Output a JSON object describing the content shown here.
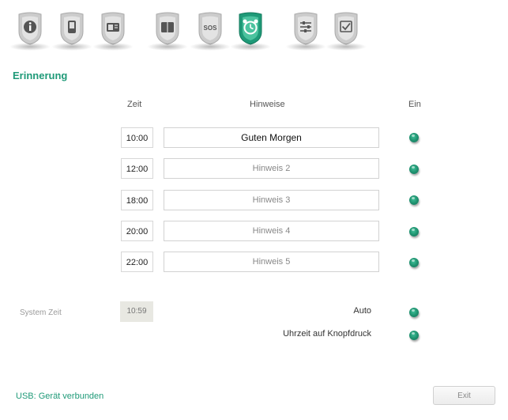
{
  "toolbar": {
    "icons": [
      {
        "name": "info-icon",
        "glyph": "i",
        "active": false
      },
      {
        "name": "phone-icon",
        "glyph": "▯",
        "active": false
      },
      {
        "name": "contact-card-icon",
        "glyph": "▭",
        "active": false
      },
      {
        "name": "phonebook-icon",
        "glyph": "▣",
        "active": false
      },
      {
        "name": "sos-icon",
        "glyph": "SOS",
        "active": false
      },
      {
        "name": "alarm-clock-icon",
        "glyph": "⏰",
        "active": true
      },
      {
        "name": "settings-sliders-icon",
        "glyph": "≡",
        "active": false
      },
      {
        "name": "checklist-icon",
        "glyph": "☑",
        "active": false
      }
    ],
    "colors": {
      "inactive": "#c9c9c9",
      "active": "#1f9a78"
    }
  },
  "section": {
    "title": "Erinnerung"
  },
  "table": {
    "headers": {
      "time": "Zeit",
      "notes": "Hinweise",
      "on": "Ein"
    },
    "rows": [
      {
        "time": "10:00",
        "note": "Guten Morgen",
        "active": true
      },
      {
        "time": "12:00",
        "note": "Hinweis 2",
        "active": false
      },
      {
        "time": "18:00",
        "note": "Hinweis 3",
        "active": false
      },
      {
        "time": "20:00",
        "note": "Hinweis 4",
        "active": false
      },
      {
        "time": "22:00",
        "note": "Hinweis 5",
        "active": false
      }
    ]
  },
  "system": {
    "label": "System Zeit",
    "time": "10:59",
    "options": [
      {
        "label": "Auto",
        "selected": true
      },
      {
        "label": "Uhrzeit auf Knopfdruck",
        "selected": true
      }
    ]
  },
  "footer": {
    "status": "USB: Gerät verbunden",
    "exit_label": "Exit"
  }
}
